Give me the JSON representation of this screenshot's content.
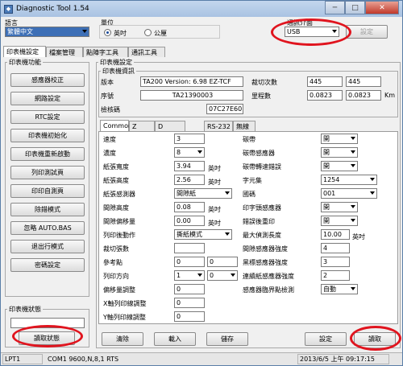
{
  "window": {
    "title": "Diagnostic Tool 1.54",
    "min": "─",
    "max": "□",
    "close": "✕"
  },
  "language": {
    "label": "語言",
    "value": "繁體中文"
  },
  "unit": {
    "label": "單位",
    "option_inch": "英吋",
    "option_mm": "公厘",
    "selected": "inch"
  },
  "interface": {
    "label": "通訊介面",
    "value": "USB",
    "setup_button": "設定"
  },
  "menu_tabs": [
    "印表機設定",
    "檔案管理",
    "點陣字工具",
    "通訊工具"
  ],
  "functions": {
    "group_label": "印表機功能",
    "buttons": [
      "感應器校正",
      "網路設定",
      "RTC設定",
      "印表機初始化",
      "印表機重新啟動",
      "列印測試頁",
      "印印自測頁",
      "除錯模式",
      "忽略 AUTO.BAS",
      "退出行模式",
      "密碼設定"
    ]
  },
  "status_group": {
    "label": "印表機狀態",
    "read_button": "讀取狀態"
  },
  "printer_setup_label": "印表機設定",
  "info": {
    "label": "印表機資訊",
    "version_label": "版本",
    "version": "TA200 Version: 6.98 EZ-TCF",
    "serial_label": "序號",
    "serial": "TA21390003",
    "checksum_label": "檢核碼",
    "checksum": "07C27E60",
    "cut_label": "裁切次數",
    "cut1": "445",
    "cut2": "445",
    "mileage_label": "里程數",
    "mileage1": "0.0823",
    "mileage2": "0.0823",
    "mileage_unit": "Km"
  },
  "sub_tabs": [
    "Common",
    "Z",
    "D",
    "RS-232",
    "無線"
  ],
  "common": {
    "speed_label": "速度",
    "speed": "3",
    "density_label": "濃度",
    "density": "8",
    "paper_width_label": "紙張寬度",
    "paper_width": "3.94",
    "paper_width_unit": "英吋",
    "paper_height_label": "紙張高度",
    "paper_height": "2.56",
    "paper_height_unit": "英吋",
    "media_sensor_label": "紙張感測器",
    "media_sensor": "間隙紙",
    "gap_height_label": "間隙高度",
    "gap_height": "0.08",
    "gap_height_unit": "英吋",
    "gap_offset_label": "間隙偏移量",
    "gap_offset": "0.00",
    "gap_offset_unit": "英吋",
    "post_print_label": "列印後動作",
    "post_print": "撕紙模式",
    "cut_count_label": "裁切張數",
    "cut_count": "",
    "ref_point_label": "參考點",
    "ref_x": "0",
    "ref_y": "0",
    "direction_label": "列印方向",
    "direction1": "1",
    "direction2": "0",
    "shift_label": "偏移量調整",
    "shift": "0",
    "x_adjust_label": "X軸列印線調整",
    "x_adjust": "0",
    "y_adjust_label": "Y軸列印線調整",
    "y_adjust": "0",
    "ribbon_label": "碳帶",
    "ribbon": "開",
    "ribbon_sensor_label": "碳帶感應器",
    "ribbon_sensor": "開",
    "ribbon_err_label": "碳帶轉速錯誤",
    "ribbon_err": "開",
    "charset_label": "字元集",
    "charset": "1254",
    "country_label": "國碼",
    "country": "001",
    "head_sensor_label": "印字頭感應器",
    "head_sensor": "開",
    "reprint_label": "錯誤後重印",
    "reprint": "開",
    "max_len_label": "最大偵測長度",
    "max_len": "10.00",
    "max_len_unit": "英吋",
    "gap_intensity_label": "間隙感應器強度",
    "gap_intensity": "4",
    "bline_intensity_label": "黑標感應器強度",
    "bline_intensity": "3",
    "cont_intensity_label": "連續紙感應器強度",
    "cont_intensity": "2",
    "threshold_label": "感應器臨界點檢測",
    "threshold": "自動"
  },
  "bottom_buttons": {
    "clear": "清除",
    "load": "載入",
    "save": "儲存",
    "set": "設定",
    "read": "讀取"
  },
  "statusbar": {
    "port": "LPT1",
    "com": "COM1 9600,N,8,1 RTS",
    "time": "2013/6/5 上午 09:17:15"
  }
}
